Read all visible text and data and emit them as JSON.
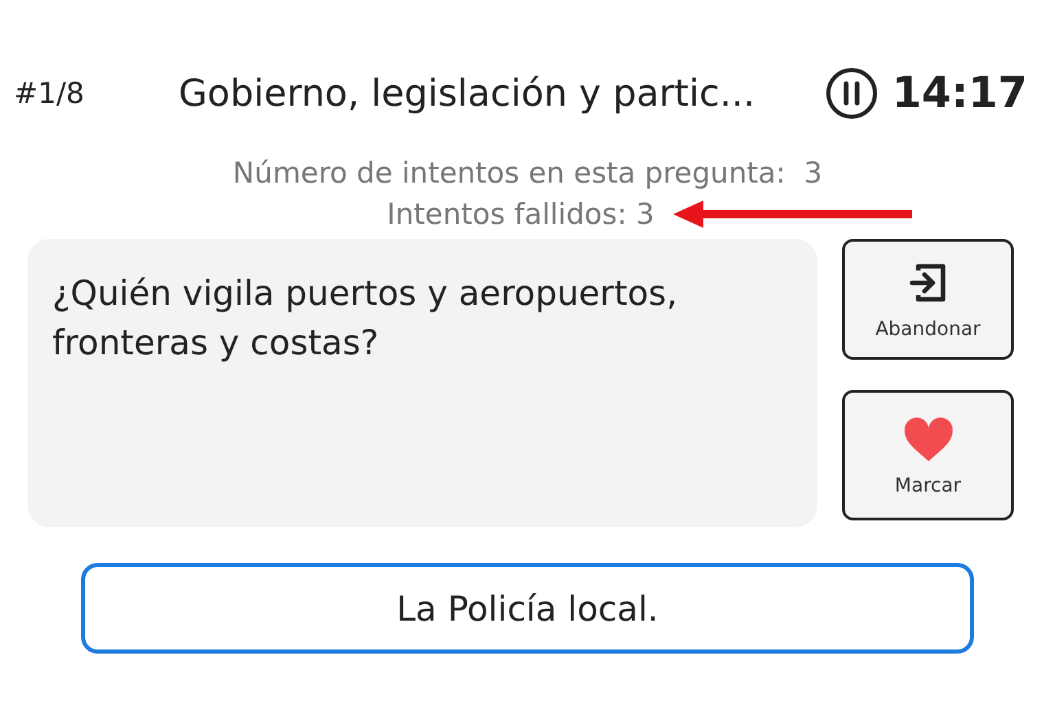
{
  "header": {
    "counter": "#1/8",
    "title": "Gobierno, legislación y partic...",
    "timer": "14:17"
  },
  "attempts": {
    "total_label": "Número de intentos en esta pregunta:",
    "total": "3",
    "failed_label": "Intentos fallidos:",
    "failed": "3"
  },
  "question": "¿Quién vigila puertos y aeropuertos, fronteras y costas?",
  "actions": [
    {
      "kind": "exit",
      "label": "Abandonar"
    },
    {
      "kind": "mark",
      "label": "Marcar"
    }
  ],
  "answers": [
    {
      "text": "La Policía local.",
      "selected": true
    }
  ]
}
